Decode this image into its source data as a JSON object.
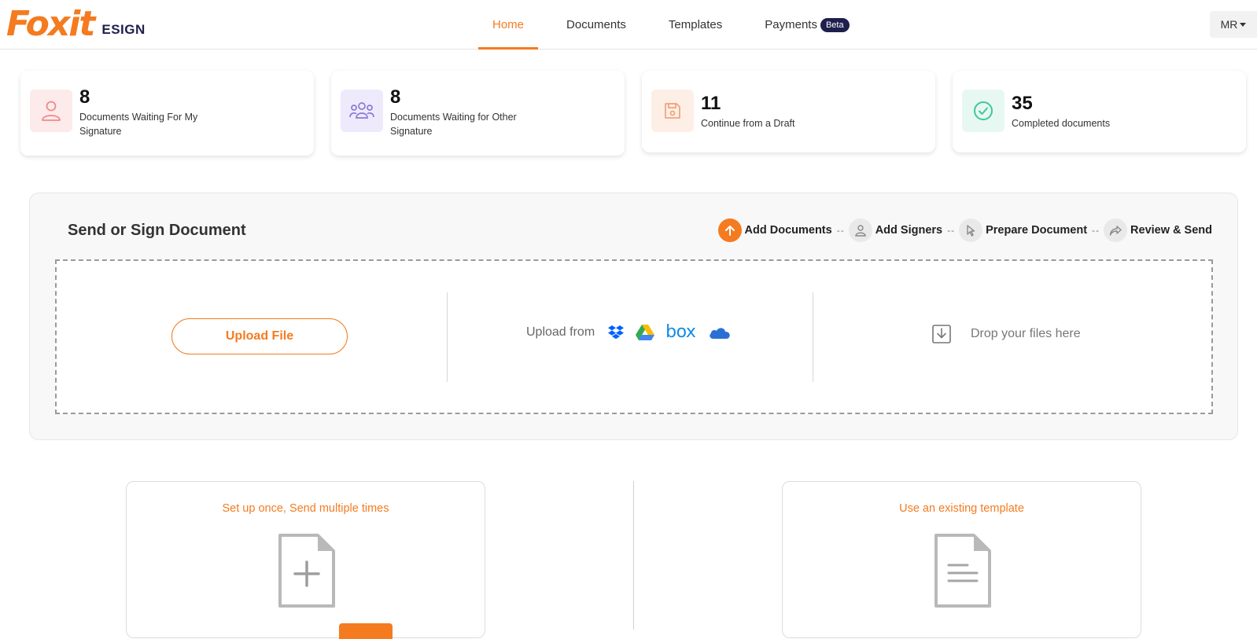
{
  "brand": {
    "logo_text": "Foxit",
    "product": "ESIGN",
    "accent": "#f47b20",
    "navy": "#1f1f4d"
  },
  "nav": {
    "items": [
      {
        "label": "Home",
        "active": true
      },
      {
        "label": "Documents"
      },
      {
        "label": "Templates"
      },
      {
        "label": "Payments",
        "badge": "Beta"
      }
    ]
  },
  "user": {
    "initials": "MR",
    "icon": "chevron-down-icon"
  },
  "stats": [
    {
      "count": "8",
      "label": "Documents Waiting For My Signature",
      "icon": "user-icon",
      "bg": "#fdeaea",
      "color": "#f08a8a"
    },
    {
      "count": "8",
      "label": "Documents Waiting for Other Signature",
      "icon": "group-icon",
      "bg": "#eeeafc",
      "color": "#8a7ad8"
    },
    {
      "count": "11",
      "label": "Continue from a Draft",
      "icon": "save-icon",
      "bg": "#fdefe6",
      "color": "#f2a57c"
    },
    {
      "count": "35",
      "label": "Completed documents",
      "icon": "check-circle-icon",
      "bg": "#e7f8f2",
      "color": "#3fc79a"
    }
  ],
  "send_panel": {
    "title": "Send or Sign Document",
    "steps": [
      {
        "label": "Add Documents",
        "icon": "upload-arrow-icon",
        "active": true
      },
      {
        "label": "Add Signers",
        "icon": "user-icon"
      },
      {
        "label": "Prepare Document",
        "icon": "cursor-icon"
      },
      {
        "label": "Review & Send",
        "icon": "share-arrow-icon"
      }
    ],
    "step_separator": "--",
    "upload_button": "Upload File",
    "upload_from_label": "Upload from",
    "cloud_sources": [
      "dropbox-icon",
      "google-drive-icon",
      "box-icon",
      "onedrive-icon"
    ],
    "box_text": "box",
    "drop_label": "Drop your files here"
  },
  "templates": [
    {
      "title": "Set up once, Send multiple times",
      "icon": "add-document-icon"
    },
    {
      "title": "Use an existing template",
      "icon": "document-lines-icon"
    }
  ]
}
